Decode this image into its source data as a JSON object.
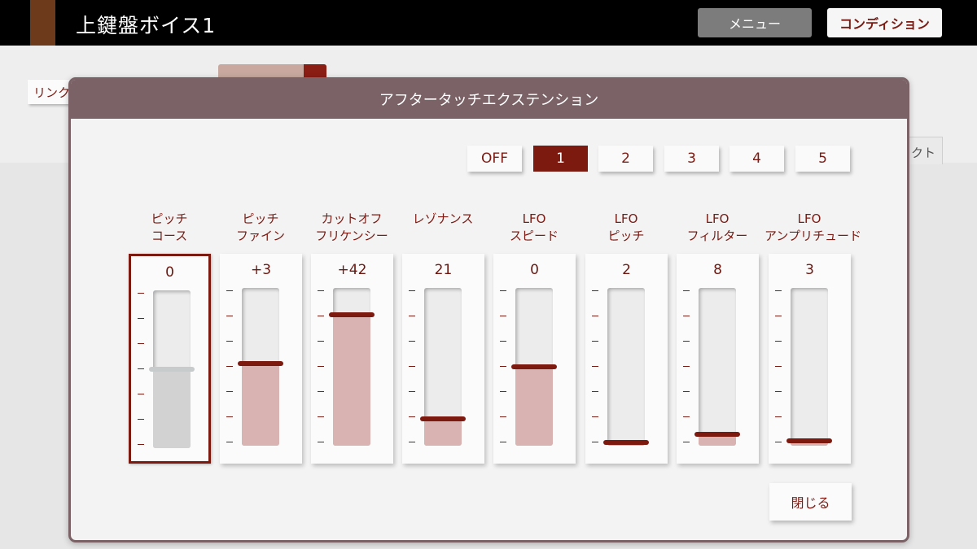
{
  "header": {
    "title": "上鍵盤ボイス1",
    "menu_label": "メニュー",
    "condition_label": "コンディション"
  },
  "background": {
    "link_label": "リンク",
    "tab_label": "クト"
  },
  "dialog": {
    "title": "アフタータッチエクステンション",
    "selector": [
      "OFF",
      "1",
      "2",
      "3",
      "4",
      "5"
    ],
    "selected_index": 1,
    "close_label": "閉じる",
    "params": [
      {
        "label_lines": [
          "ピッチ",
          "コース"
        ],
        "value": "0",
        "level": 0.5,
        "selected": true
      },
      {
        "label_lines": [
          "ピッチ",
          "ファイン"
        ],
        "value": "+3",
        "level": 0.52
      },
      {
        "label_lines": [
          "カットオフ",
          "フリケンシー"
        ],
        "value": "+42",
        "level": 0.83
      },
      {
        "label_lines": [
          "レゾナンス"
        ],
        "value": "21",
        "level": 0.17
      },
      {
        "label_lines": [
          "LFO",
          "スピード"
        ],
        "value": "0",
        "level": 0.5
      },
      {
        "label_lines": [
          "LFO",
          "ピッチ"
        ],
        "value": "2",
        "level": 0.02
      },
      {
        "label_lines": [
          "LFO",
          "フィルター"
        ],
        "value": "8",
        "level": 0.07
      },
      {
        "label_lines": [
          "LFO",
          "アンプリチュード"
        ],
        "value": "3",
        "level": 0.03
      }
    ]
  },
  "colors": {
    "accent": "#7d1a10",
    "header": "#7a6266",
    "fill": "#d9b2b2"
  }
}
